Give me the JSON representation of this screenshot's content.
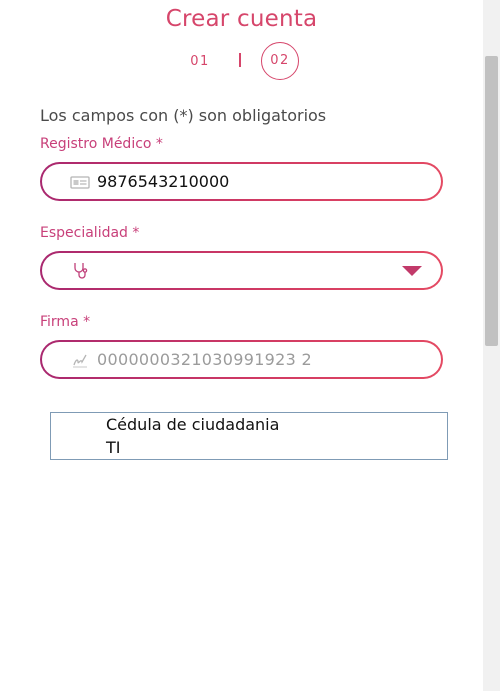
{
  "header": {
    "title": "Crear cuenta"
  },
  "steps": {
    "step1": "01",
    "step2": "02",
    "current": "02"
  },
  "form": {
    "notice": "Los campos con (*) son obligatorios",
    "registro": {
      "label": "Registro Médico *",
      "value": "9876543210000",
      "icon": "id-card-icon"
    },
    "especialidad": {
      "label": "Especialidad *",
      "value": "",
      "icon": "stethoscope-icon"
    },
    "firma": {
      "label": "Firma *",
      "placeholder": "0000000321030991923 2",
      "icon": "signature-icon"
    }
  },
  "dropdown": {
    "options": [
      "Cédula de ciudadania",
      "TI"
    ]
  },
  "colors": {
    "accent": "#d6466b",
    "label": "#c8407a",
    "border_start": "#a9286f",
    "border_end": "#e44a63"
  }
}
